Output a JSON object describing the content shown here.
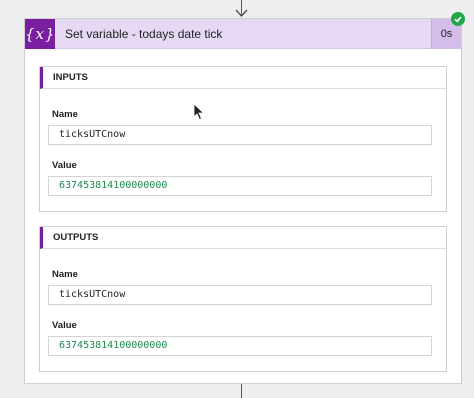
{
  "action": {
    "icon_glyph": "{x}",
    "icon": "variable-icon",
    "title": "Set variable - todays date tick",
    "duration": "0s",
    "status_icon": "check-circle-icon",
    "status_color": "#22a84a",
    "accent_color": "#7a1fa2",
    "header_bg": "#e6d9f4"
  },
  "inputs": {
    "heading": "INPUTS",
    "name_label": "Name",
    "name_value": "ticksUTCnow",
    "value_label": "Value",
    "value_value": "637453814100000000"
  },
  "outputs": {
    "heading": "OUTPUTS",
    "name_label": "Name",
    "name_value": "ticksUTCnow",
    "value_label": "Value",
    "value_value": "637453814100000000"
  }
}
